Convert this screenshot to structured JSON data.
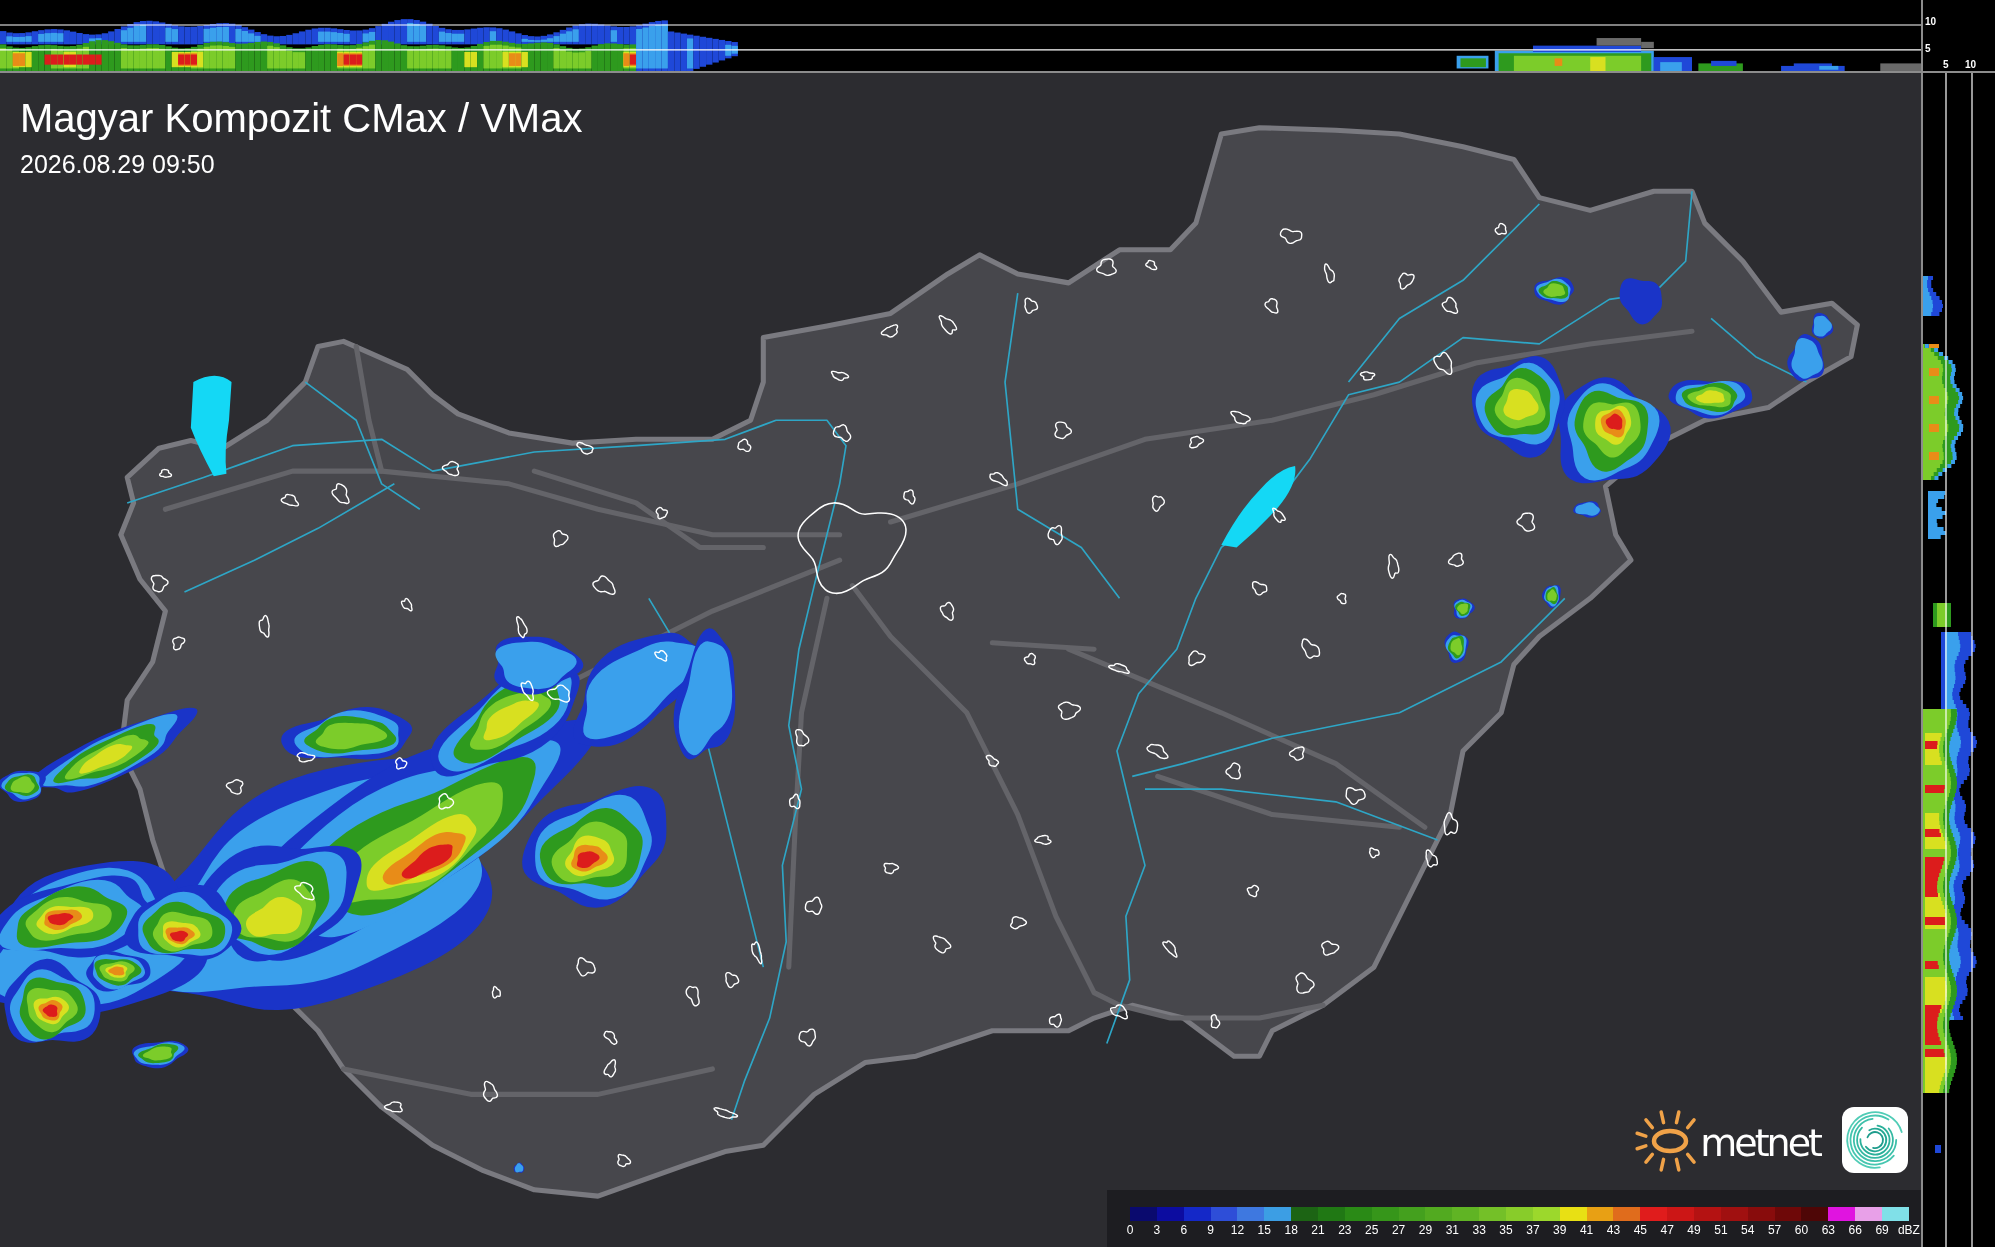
{
  "title": "Magyar Kompozit CMax / VMax",
  "timestamp": "2026.08.29 09:50",
  "top_profile": {
    "axis_labels": [
      "10",
      "5"
    ]
  },
  "side_profile": {
    "axis_labels": [
      "5",
      "10"
    ]
  },
  "legend": {
    "items": [
      {
        "label": "0",
        "color": "#0a0a6e"
      },
      {
        "label": "3",
        "color": "#0c0ca0"
      },
      {
        "label": "6",
        "color": "#1428c8"
      },
      {
        "label": "9",
        "color": "#2e4ed8"
      },
      {
        "label": "12",
        "color": "#3e78e0"
      },
      {
        "label": "15",
        "color": "#3c9ee4"
      },
      {
        "label": "18",
        "color": "#1c6414"
      },
      {
        "label": "21",
        "color": "#207814"
      },
      {
        "label": "23",
        "color": "#2a8a16"
      },
      {
        "label": "25",
        "color": "#36961a"
      },
      {
        "label": "27",
        "color": "#44a01e"
      },
      {
        "label": "29",
        "color": "#52aa20"
      },
      {
        "label": "31",
        "color": "#60b424"
      },
      {
        "label": "33",
        "color": "#74c028"
      },
      {
        "label": "35",
        "color": "#88cc2a"
      },
      {
        "label": "37",
        "color": "#9cd82c"
      },
      {
        "label": "39",
        "color": "#e8e014"
      },
      {
        "label": "41",
        "color": "#e8a014"
      },
      {
        "label": "43",
        "color": "#e06c1c"
      },
      {
        "label": "45",
        "color": "#e01c1c"
      },
      {
        "label": "47",
        "color": "#cc1616"
      },
      {
        "label": "49",
        "color": "#b41212"
      },
      {
        "label": "51",
        "color": "#a01010"
      },
      {
        "label": "54",
        "color": "#880c0c"
      },
      {
        "label": "57",
        "color": "#6e0808"
      },
      {
        "label": "60",
        "color": "#4e0606"
      },
      {
        "label": "63",
        "color": "#e014e0"
      },
      {
        "label": "66",
        "color": "#e8a0e8"
      },
      {
        "label": "69",
        "color": "#80e0e8"
      }
    ],
    "unit": "dBZ"
  },
  "logo": {
    "text": "metnet"
  }
}
